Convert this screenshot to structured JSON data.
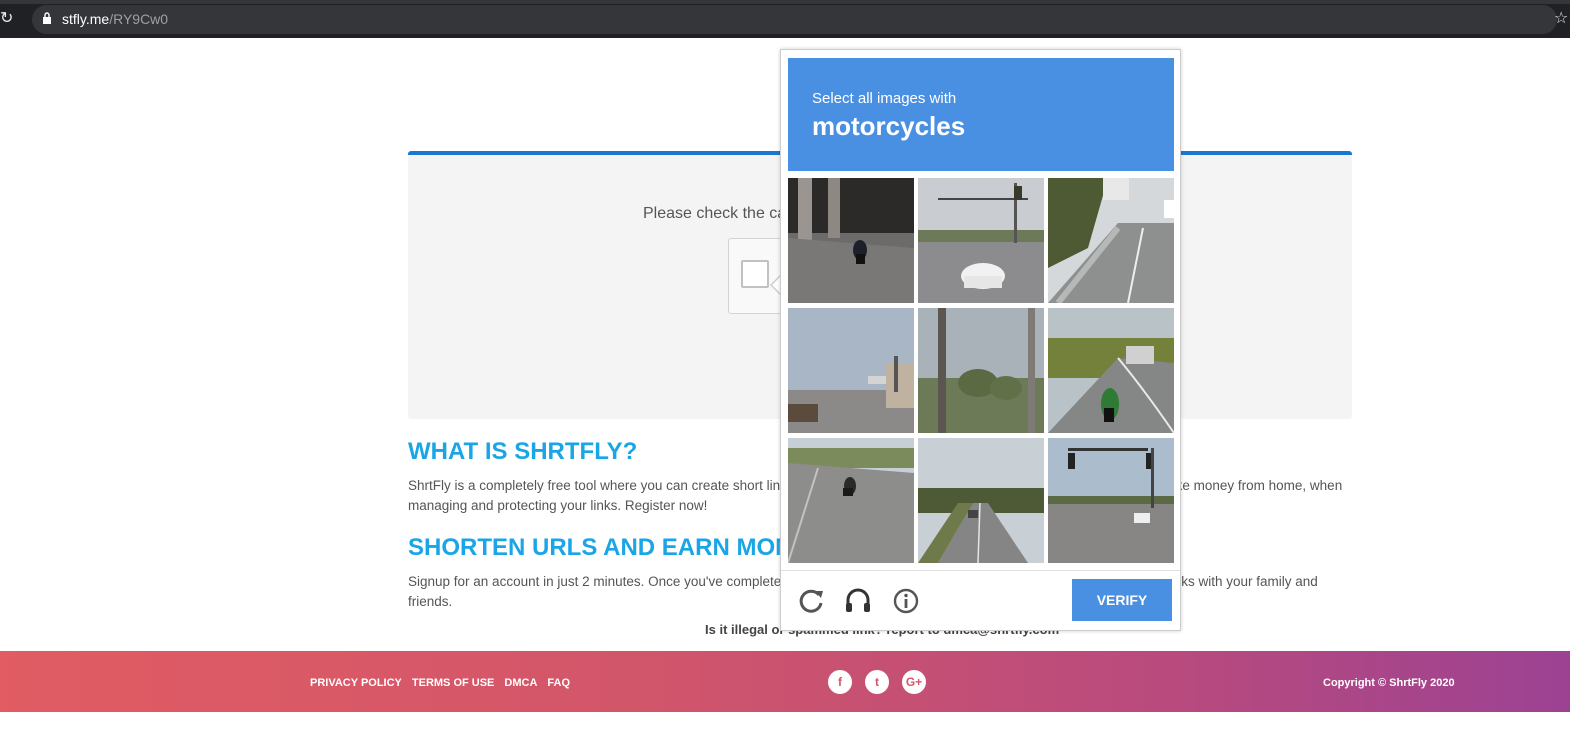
{
  "browser": {
    "url_host": "stfly.me",
    "url_path": "/RY9Cw0"
  },
  "page": {
    "captcha_prompt": "Please check the captcha box to proceed to the destination page.",
    "section1_title": "WHAT IS SHRTFLY?",
    "section1_text": "ShrtFly is a completely free tool where you can create short links, which apart from being free, you get paid! So, now you can make money from home, when managing and protecting your links. Register now!",
    "section2_title": "SHORTEN URLS AND EARN MONEY",
    "section2_text": "Signup for an account in just 2 minutes. Once you've completed your registration just start creating short URLs and sharing the links with your family and friends.",
    "report_text": "Is it illegal or spammed link? report to dmca@shrtfly.com"
  },
  "footer": {
    "links": [
      "PRIVACY POLICY",
      "TERMS OF USE",
      "DMCA",
      "FAQ"
    ],
    "social": [
      {
        "icon": "facebook-icon",
        "glyph": "f"
      },
      {
        "icon": "twitter-icon",
        "glyph": "t"
      },
      {
        "icon": "google-plus-icon",
        "glyph": "G+"
      }
    ],
    "copyright": "Copyright © ShrtFly 2020"
  },
  "challenge": {
    "instruction": "Select all images with",
    "target": "motorcycles",
    "verify_label": "VERIFY",
    "tiles": [
      {
        "scene": "overpass road with motorcycle"
      },
      {
        "scene": "intersection with white suv"
      },
      {
        "scene": "highway with guardrail"
      },
      {
        "scene": "street with signs"
      },
      {
        "scene": "utility pole and palm trees"
      },
      {
        "scene": "curved road with motorcycle"
      },
      {
        "scene": "road with motorcycle"
      },
      {
        "scene": "divided highway"
      },
      {
        "scene": "intersection with traffic lights"
      }
    ],
    "icons": [
      "reload-icon",
      "audio-headphones-icon",
      "info-icon"
    ],
    "colors": {
      "header": "#4a90e2",
      "button": "#4a90e2"
    }
  }
}
